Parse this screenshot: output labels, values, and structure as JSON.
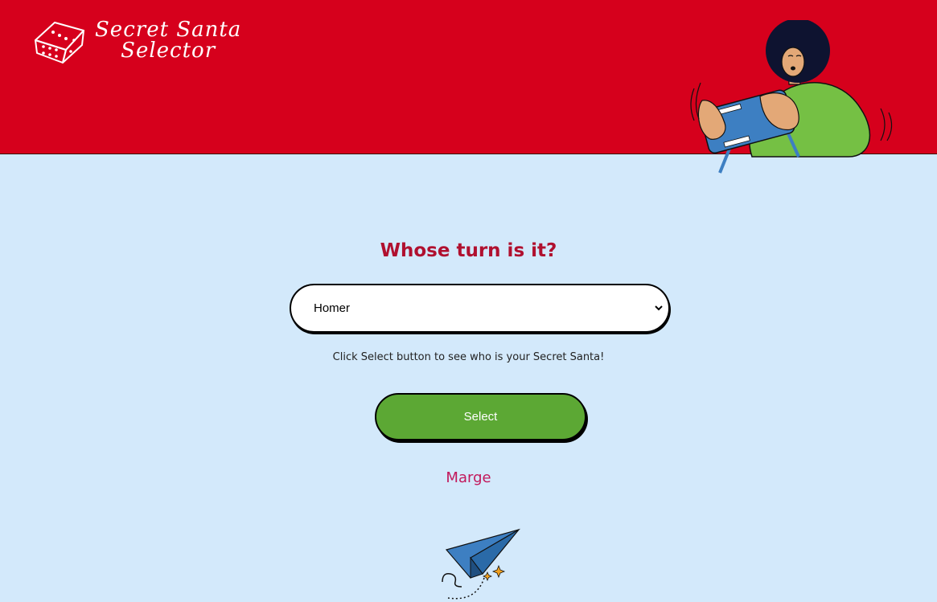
{
  "header": {
    "logo_line1": "Secret Santa",
    "logo_line2": "Selector",
    "bg_color": "#d6001c"
  },
  "main": {
    "title": "Whose turn is it?",
    "select": {
      "selected_value": "Homer"
    },
    "hint": "Click Select button to see who is your Secret Santa!",
    "select_button_label": "Select",
    "result": "Marge"
  },
  "icons": [
    "dice-icon",
    "person-gaming-illustration",
    "chevron-down-icon",
    "paper-plane-illustration"
  ]
}
